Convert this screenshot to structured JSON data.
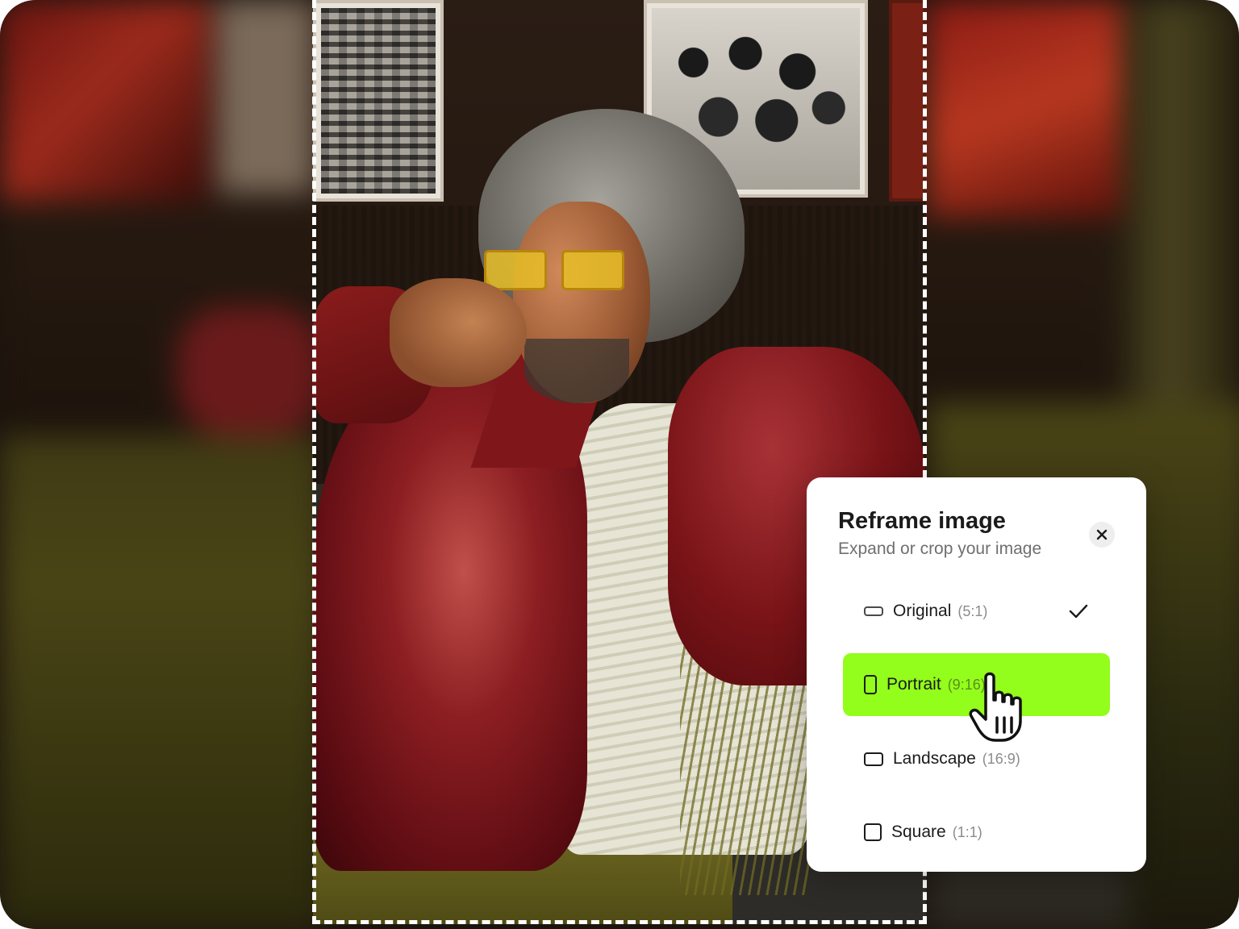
{
  "dialog": {
    "title": "Reframe image",
    "subtitle": "Expand or crop your image",
    "options": [
      {
        "label": "Original",
        "ratio": "(5:1)",
        "icon": "wide-rectangle-icon",
        "checked": true,
        "highlighted": false
      },
      {
        "label": "Portrait",
        "ratio": "(9:16)",
        "icon": "tall-rectangle-icon",
        "checked": false,
        "highlighted": true
      },
      {
        "label": "Landscape",
        "ratio": "(16:9)",
        "icon": "landscape-rectangle-icon",
        "checked": false,
        "highlighted": false
      },
      {
        "label": "Square",
        "ratio": "(1:1)",
        "icon": "square-icon",
        "checked": false,
        "highlighted": false
      }
    ],
    "close_icon": "close-icon",
    "check_icon": "check-icon"
  },
  "colors": {
    "highlight": "#93fd1b",
    "dialog_bg": "#ffffff",
    "frame_outline": "#ffffff"
  },
  "cursor": "hand-pointer-icon"
}
